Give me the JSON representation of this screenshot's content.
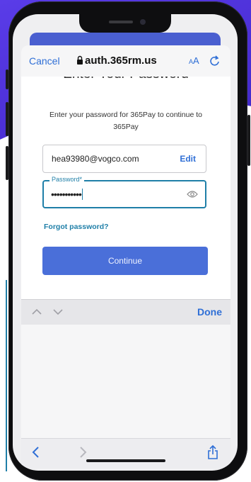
{
  "browser": {
    "cancel_label": "Cancel",
    "url": "auth.365rm.us",
    "text_size_label": "AA"
  },
  "page": {
    "heading_partial": "Enter Your Password",
    "intro": "Enter your password for 365Pay to continue to 365Pay",
    "email_value": "hea93980@vogco.com",
    "edit_label": "Edit",
    "password_label": "Password*",
    "password_masked": "•••••••••••",
    "forgot_label": "Forgot password?",
    "continue_label": "Continue"
  },
  "keyboard_toolbar": {
    "done_label": "Done"
  },
  "colors": {
    "link_blue": "#2f6fd6",
    "focus_teal": "#1f7fa8",
    "button_blue": "#4a6fd9",
    "brand_purple": "#4b2fd6"
  },
  "icons": [
    "lock-icon",
    "reload-icon",
    "eye-icon",
    "chevron-up-icon",
    "chevron-down-icon",
    "back-arrow-icon",
    "forward-arrow-icon",
    "share-icon"
  ]
}
